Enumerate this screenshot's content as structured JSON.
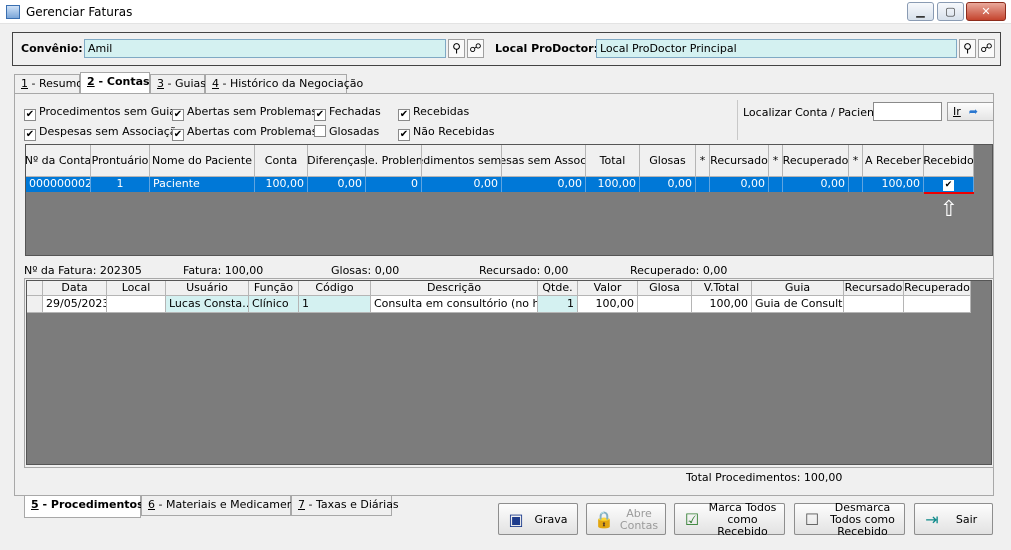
{
  "window": {
    "title": "Gerenciar Faturas",
    "min": "▁",
    "max": "▢",
    "close": "✕"
  },
  "convenio": {
    "label": "Convênio:",
    "value": "Amil",
    "local_label": "Local ProDoctor:",
    "local_value": "Local ProDoctor Principal"
  },
  "tabs_top": [
    {
      "key": "1",
      "label": " - Resumo"
    },
    {
      "key": "2",
      "label": " - Contas"
    },
    {
      "key": "3",
      "label": " - Guias"
    },
    {
      "key": "4",
      "label": " - Histórico da Negociação"
    }
  ],
  "filters": [
    {
      "label": "Procedimentos sem Guia",
      "checked": true
    },
    {
      "label": "Abertas sem Problemas",
      "checked": true
    },
    {
      "label": "Fechadas",
      "checked": true
    },
    {
      "label": "Recebidas",
      "checked": true
    },
    {
      "label": "Despesas sem Associação",
      "checked": true
    },
    {
      "label": "Abertas com Problemas",
      "checked": true
    },
    {
      "label": "Glosadas",
      "checked": false
    },
    {
      "label": "Não Recebidas",
      "checked": true
    }
  ],
  "localizar": {
    "label": "Localizar Conta / Paciente:",
    "value": "",
    "go_label": "Ir"
  },
  "contas_table": {
    "headers": [
      "Nº da Conta",
      "Prontuário",
      "Nome do Paciente",
      "Conta",
      "Diferenças",
      "Qtde. Problemas",
      "Procedimentos sem Guia",
      "Despesas sem Associação",
      "Total",
      "Glosas",
      "*",
      "Recursado",
      "*",
      "Recuperado",
      "*",
      "A Receber",
      "Recebido"
    ],
    "row": [
      "000000002",
      "1",
      "Paciente",
      "100,00",
      "0,00",
      "0",
      "0,00",
      "0,00",
      "100,00",
      "0,00",
      "",
      "0,00",
      "",
      "0,00",
      "",
      "100,00",
      "✔"
    ]
  },
  "summary": {
    "fatura_no": "Nº da Fatura: 202305",
    "fatura": "Fatura: 100,00",
    "glosas": "Glosas: 0,00",
    "recursado": "Recursado: 0,00",
    "recuperado": "Recuperado: 0,00"
  },
  "proc_table": {
    "headers": [
      "",
      "Data",
      "Local",
      "Usuário",
      "Função",
      "Código",
      "Descrição",
      "Qtde.",
      "Valor",
      "Glosa",
      "V.Total",
      "Guia",
      "Recursado",
      "Recuperado"
    ],
    "row": [
      "",
      "29/05/2023",
      "",
      "Lucas Consta…",
      "Clínico",
      "1",
      "Consulta em consultório (no ho…",
      "1",
      "100,00",
      "",
      "100,00",
      "Guia de Consultas",
      "",
      ""
    ]
  },
  "total_procedimentos": "Total Procedimentos: 100,00",
  "tabs_bottom": [
    {
      "key": "5",
      "label": " - Procedimentos"
    },
    {
      "key": "6",
      "label": " - Materiais e Medicamentos"
    },
    {
      "key": "7",
      "label": " - Taxas e Diárias"
    }
  ],
  "actions": {
    "grava": "Grava",
    "abre_contas": "Abre Contas",
    "marca_todos": "Marca Todos como Recebido",
    "desmarca_todos": "Desmarca Todos como Recebido",
    "sair": "Sair"
  }
}
